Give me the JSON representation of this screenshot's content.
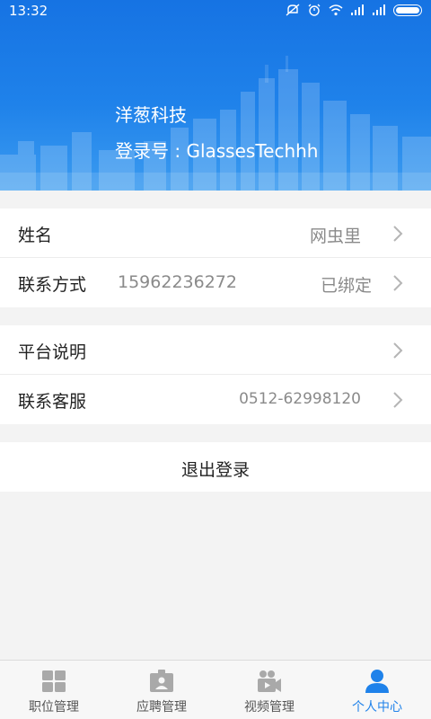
{
  "status_bar": {
    "time": "13:32"
  },
  "profile": {
    "company": "洋葱科技",
    "login_label": "登录号 : ",
    "login_id": "GlassesTechhh"
  },
  "info_group": [
    {
      "label": "姓名",
      "mid": "",
      "value": "网虫里"
    },
    {
      "label": "联系方式",
      "mid": "15962236272",
      "value": "已绑定"
    }
  ],
  "about_group": [
    {
      "label": "平台说明",
      "value": ""
    },
    {
      "label": "联系客服",
      "value": "0512-62998120"
    }
  ],
  "logout_label": "退出登录",
  "tabs": [
    {
      "label": "职位管理",
      "icon": "grid-icon",
      "active": false
    },
    {
      "label": "应聘管理",
      "icon": "badge-icon",
      "active": false
    },
    {
      "label": "视频管理",
      "icon": "video-camera-icon",
      "active": false
    },
    {
      "label": "个人中心",
      "icon": "person-icon",
      "active": true
    }
  ],
  "colors": {
    "accent": "#1f82ea",
    "header_top": "#1673e3",
    "background": "#f3f3f3"
  }
}
